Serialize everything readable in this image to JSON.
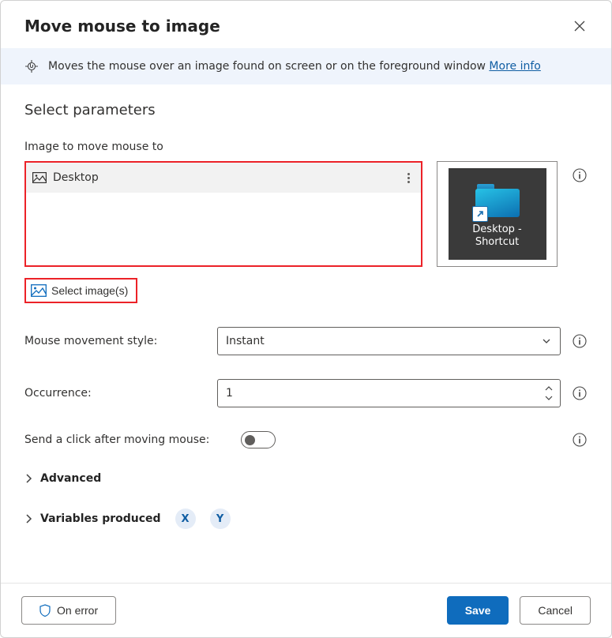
{
  "dialog": {
    "title": "Move mouse to image",
    "banner_text": "Moves the mouse over an image found on screen or on the foreground window ",
    "more_info": "More info"
  },
  "params": {
    "section_title": "Select parameters",
    "image_label": "Image to move mouse to",
    "selected_image_name": "Desktop",
    "preview_caption_line1": "Desktop -",
    "preview_caption_line2": "Shortcut",
    "select_images_label": "Select image(s)",
    "movement_label": "Mouse movement style:",
    "movement_value": "Instant",
    "occurrence_label": "Occurrence:",
    "occurrence_value": "1",
    "send_click_label": "Send a click after moving mouse:",
    "advanced_label": "Advanced",
    "vars_label": "Variables produced",
    "var_x": "X",
    "var_y": "Y"
  },
  "footer": {
    "on_error": "On error",
    "save": "Save",
    "cancel": "Cancel"
  }
}
